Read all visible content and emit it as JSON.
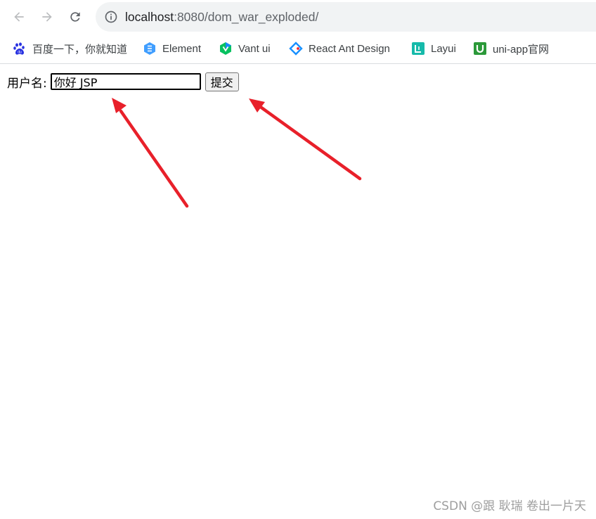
{
  "browser": {
    "url_host": "localhost",
    "url_rest": ":8080/dom_war_exploded/"
  },
  "bookmarks": [
    {
      "label": "百度一下，你就知道",
      "icon": "baidu-paw-icon",
      "color": "#2932e1"
    },
    {
      "label": "Element",
      "icon": "element-icon",
      "color": "#409eff"
    },
    {
      "label": "Vant ui",
      "icon": "vant-icon",
      "color": "#07c160"
    },
    {
      "label": "React Ant Design",
      "icon": "ant-design-icon",
      "color": "#1890ff"
    },
    {
      "label": "Layui",
      "icon": "layui-icon",
      "color": "#16baaa"
    },
    {
      "label": "uni-app官网",
      "icon": "uni-app-icon",
      "color": "#2b9939"
    }
  ],
  "form": {
    "label": "用户名:",
    "input_value": "你好 JSP",
    "submit_label": "提交"
  },
  "annotation": {
    "arrow_color": "#e8202a"
  },
  "watermark": "CSDN @跟 耿瑞 卷出一片天"
}
